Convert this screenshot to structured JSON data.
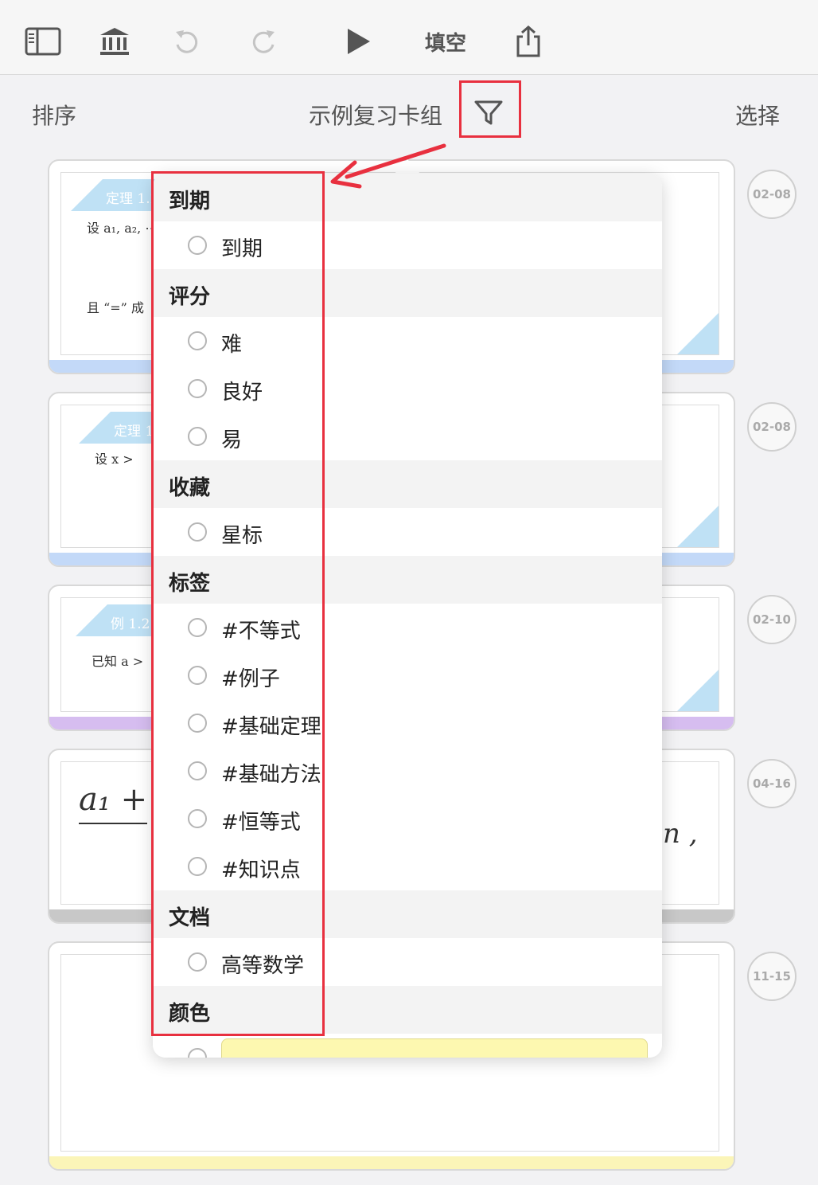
{
  "toolbar": {
    "icons": [
      "sidebar-icon",
      "library-icon",
      "undo-icon",
      "redo-icon",
      "play-icon"
    ],
    "mode_label": "填空",
    "share_icon": "share-icon"
  },
  "header": {
    "sort_label": "排序",
    "deck_title": "示例复习卡组",
    "filter_icon": "filter-icon",
    "select_label": "选择"
  },
  "cards": [
    {
      "tag": "定理 1.2",
      "line1": "设 a₁, a₂, ⋯",
      "line2": "且 “=” 成",
      "date": "02-08",
      "strip_color": "#c3d9f8"
    },
    {
      "tag": "定理 1",
      "line1": "设 x >",
      "line2": "",
      "date": "02-08",
      "strip_color": "#c3d9f8"
    },
    {
      "tag": "例 1.2.1",
      "line1": "已知 a >",
      "line2": "",
      "date": "02-10",
      "strip_color": "#d6bdf0"
    },
    {
      "tag": "",
      "line1": "a₁ +",
      "line2": "n ,",
      "date": "04-16",
      "strip_color": "#c8c8c8"
    },
    {
      "tag": "",
      "line1": "",
      "line2": "",
      "date": "11-15",
      "strip_color": "#fbf5b8"
    }
  ],
  "filter_menu": {
    "sections": [
      {
        "title": "到期",
        "items": [
          "到期"
        ]
      },
      {
        "title": "评分",
        "items": [
          "难",
          "良好",
          "易"
        ]
      },
      {
        "title": "收藏",
        "items": [
          "星标"
        ]
      },
      {
        "title": "标签",
        "items": [
          "#不等式",
          "#例子",
          "#基础定理",
          "#基础方法",
          "#恒等式",
          "#知识点"
        ]
      },
      {
        "title": "文档",
        "items": [
          "高等数学"
        ]
      },
      {
        "title": "颜色",
        "items": []
      }
    ],
    "color_option": "#fdf8b0"
  },
  "colors": {
    "highlight": "#e8303f",
    "card_tag": "#bfe1f5"
  }
}
